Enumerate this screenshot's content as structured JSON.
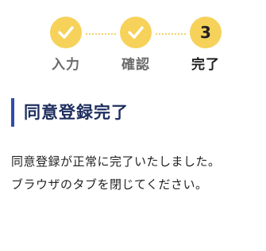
{
  "stepper": {
    "steps": [
      {
        "label": "入力",
        "state": "done",
        "icon": "check-icon"
      },
      {
        "label": "確認",
        "state": "done",
        "icon": "check-icon"
      },
      {
        "label": "完了",
        "state": "current",
        "number": "3"
      }
    ],
    "colors": {
      "circle": "#f6d25a",
      "connector": "#f0d264",
      "done_label": "#6b6b6b",
      "current_label": "#222222"
    }
  },
  "page": {
    "title": "同意登録完了",
    "title_accent_color": "#2f4da8",
    "message_line1": "同意登録が正常に完了いたしました。",
    "message_line2": "ブラウザのタブを閉じてください。"
  }
}
